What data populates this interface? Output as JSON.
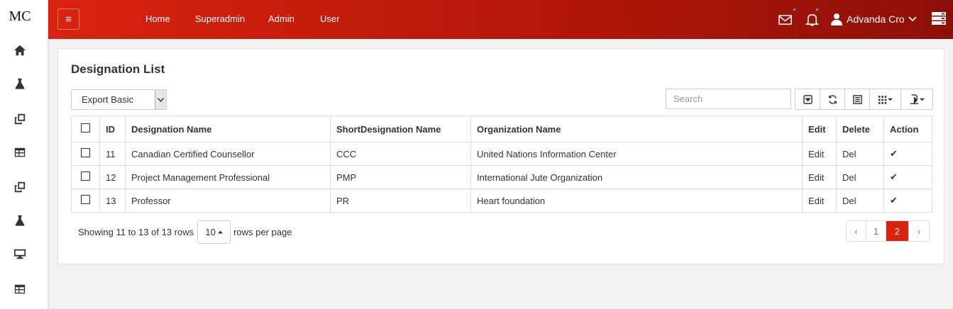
{
  "app": {
    "logo": "MC"
  },
  "sidebar": {
    "items": [
      {
        "icon": "home-icon"
      },
      {
        "icon": "flask-icon"
      },
      {
        "icon": "clone-icon"
      },
      {
        "icon": "table-icon"
      },
      {
        "icon": "clone-icon"
      },
      {
        "icon": "flask-icon"
      },
      {
        "icon": "desktop-icon"
      },
      {
        "icon": "table-icon"
      }
    ]
  },
  "topbar": {
    "menu_icon": "≡",
    "nav": [
      "Home",
      "Superadmin",
      "Admin",
      "User"
    ],
    "user_name": "Advanda Cro",
    "colors": {
      "start": "#d9230f",
      "end": "#8e0f08"
    }
  },
  "page": {
    "title": "Designation List",
    "export_select": {
      "value": "Export Basic"
    },
    "search": {
      "placeholder": "Search",
      "value": ""
    },
    "table": {
      "headers": [
        "ID",
        "Designation Name",
        "ShortDesignation Name",
        "Organization Name",
        "Edit",
        "Delete",
        "Action"
      ],
      "rows": [
        {
          "id": "11",
          "name": "Canadian Certified Counsellor",
          "short": "CCC",
          "org": "United Nations Information Center",
          "edit": "Edit",
          "del": "Del",
          "action": "✔"
        },
        {
          "id": "12",
          "name": "Project Management Professional",
          "short": "PMP",
          "org": "International Jute Organization",
          "edit": "Edit",
          "del": "Del",
          "action": "✔"
        },
        {
          "id": "13",
          "name": "Professor",
          "short": "PR",
          "org": "Heart foundation",
          "edit": "Edit",
          "del": "Del",
          "action": "✔"
        }
      ]
    },
    "footer": {
      "showing": "Showing 11 to 13 of 13 rows",
      "page_size": "10",
      "rows_per_page": "rows per page"
    },
    "pagination": {
      "prev": "‹",
      "pages": [
        "1",
        "2"
      ],
      "active": "2",
      "next": "›"
    },
    "accent": "#d9230f"
  }
}
